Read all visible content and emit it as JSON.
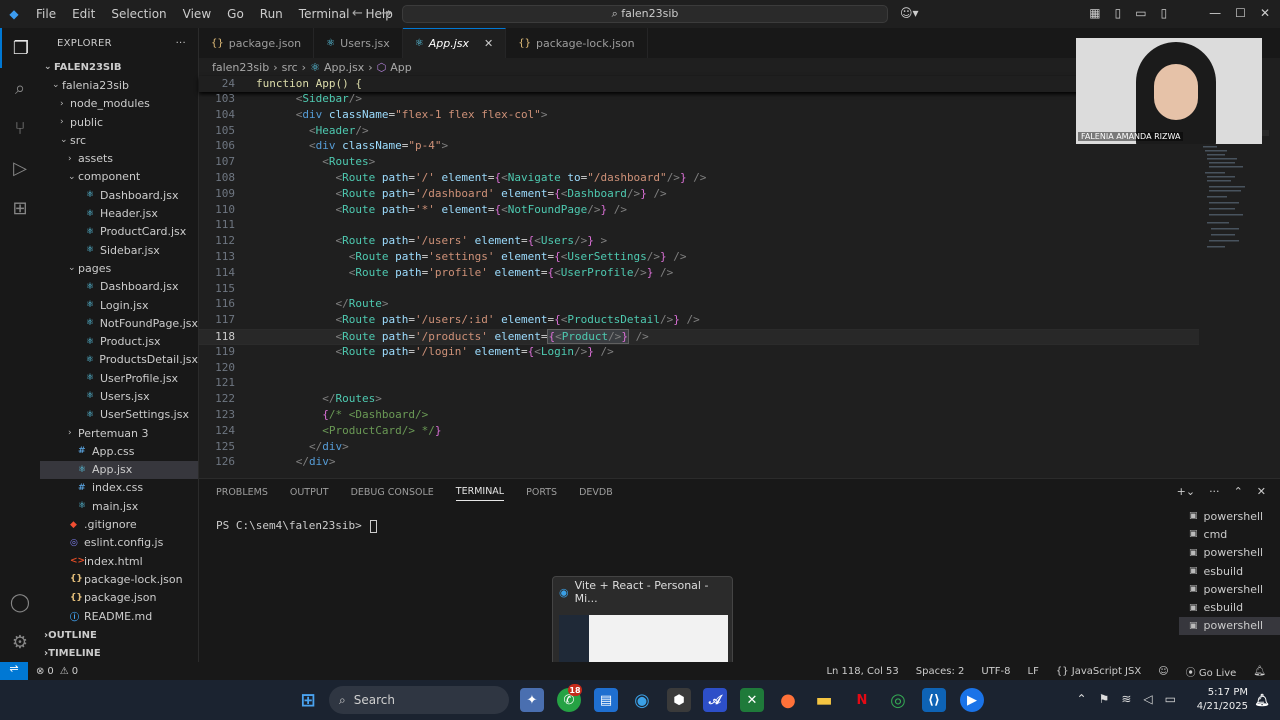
{
  "titlebar": {
    "menu": [
      "File",
      "Edit",
      "Selection",
      "View",
      "Go",
      "Run",
      "Terminal",
      "Help"
    ],
    "command_center": "falen23sib"
  },
  "sidebar": {
    "header": "EXPLORER",
    "root": "FALEN23SIB",
    "tree": [
      {
        "label": "falenia23sib",
        "depth": 1,
        "kind": "folder-open"
      },
      {
        "label": "node_modules",
        "depth": 2,
        "kind": "folder"
      },
      {
        "label": "public",
        "depth": 2,
        "kind": "folder"
      },
      {
        "label": "src",
        "depth": 2,
        "kind": "folder-open"
      },
      {
        "label": "assets",
        "depth": 3,
        "kind": "folder"
      },
      {
        "label": "component",
        "depth": 3,
        "kind": "folder-open"
      },
      {
        "label": "Dashboard.jsx",
        "depth": 4,
        "kind": "jsx"
      },
      {
        "label": "Header.jsx",
        "depth": 4,
        "kind": "jsx"
      },
      {
        "label": "ProductCard.jsx",
        "depth": 4,
        "kind": "jsx"
      },
      {
        "label": "Sidebar.jsx",
        "depth": 4,
        "kind": "jsx"
      },
      {
        "label": "pages",
        "depth": 3,
        "kind": "folder-open"
      },
      {
        "label": "Dashboard.jsx",
        "depth": 4,
        "kind": "jsx"
      },
      {
        "label": "Login.jsx",
        "depth": 4,
        "kind": "jsx"
      },
      {
        "label": "NotFoundPage.jsx",
        "depth": 4,
        "kind": "jsx"
      },
      {
        "label": "Product.jsx",
        "depth": 4,
        "kind": "jsx"
      },
      {
        "label": "ProductsDetail.jsx",
        "depth": 4,
        "kind": "jsx"
      },
      {
        "label": "UserProfile.jsx",
        "depth": 4,
        "kind": "jsx"
      },
      {
        "label": "Users.jsx",
        "depth": 4,
        "kind": "jsx"
      },
      {
        "label": "UserSettings.jsx",
        "depth": 4,
        "kind": "jsx"
      },
      {
        "label": "Pertemuan 3",
        "depth": 3,
        "kind": "folder"
      },
      {
        "label": "App.css",
        "depth": 3,
        "kind": "css"
      },
      {
        "label": "App.jsx",
        "depth": 3,
        "kind": "jsx",
        "selected": true
      },
      {
        "label": "index.css",
        "depth": 3,
        "kind": "css"
      },
      {
        "label": "main.jsx",
        "depth": 3,
        "kind": "jsx"
      },
      {
        "label": ".gitignore",
        "depth": 2,
        "kind": "git"
      },
      {
        "label": "eslint.config.js",
        "depth": 2,
        "kind": "eslint"
      },
      {
        "label": "index.html",
        "depth": 2,
        "kind": "html"
      },
      {
        "label": "package-lock.json",
        "depth": 2,
        "kind": "json"
      },
      {
        "label": "package.json",
        "depth": 2,
        "kind": "json"
      },
      {
        "label": "README.md",
        "depth": 2,
        "kind": "md"
      }
    ],
    "outline": "OUTLINE",
    "timeline": "TIMELINE"
  },
  "tabs": [
    {
      "label": "package.json",
      "icon": "{}",
      "active": false
    },
    {
      "label": "Users.jsx",
      "icon": "jsx",
      "active": false
    },
    {
      "label": "App.jsx",
      "icon": "jsx",
      "active": true
    },
    {
      "label": "package-lock.json",
      "icon": "{}",
      "active": false
    }
  ],
  "breadcrumbs": [
    "falen23sib",
    "src",
    "App.jsx",
    "App"
  ],
  "sticky": {
    "num": "24",
    "code": "function App() {"
  },
  "code_lines": [
    {
      "num": "103",
      "html": "      <span class=\"k\">&lt;</span><span class=\"t\">Sidebar</span><span class=\"k\">/&gt;</span>"
    },
    {
      "num": "104",
      "html": "      <span class=\"k\">&lt;</span><span class=\"kw\">div</span> <span class=\"a\">className</span><span class=\"p\">=</span><span class=\"s\">\"flex-1 flex flex-col\"</span><span class=\"k\">&gt;</span>"
    },
    {
      "num": "105",
      "html": "        <span class=\"k\">&lt;</span><span class=\"t\">Header</span><span class=\"k\">/&gt;</span>"
    },
    {
      "num": "106",
      "html": "        <span class=\"k\">&lt;</span><span class=\"kw\">div</span> <span class=\"a\">className</span><span class=\"p\">=</span><span class=\"s\">\"p-4\"</span><span class=\"k\">&gt;</span>"
    },
    {
      "num": "107",
      "html": "          <span class=\"k\">&lt;</span><span class=\"t\">Routes</span><span class=\"k\">&gt;</span>"
    },
    {
      "num": "108",
      "html": "            <span class=\"k\">&lt;</span><span class=\"t\">Route</span> <span class=\"a\">path</span><span class=\"p\">=</span><span class=\"s\">'/'</span> <span class=\"a\">element</span><span class=\"p\">=</span><span class=\"b\">{</span><span class=\"k\">&lt;</span><span class=\"t\">Navigate</span> <span class=\"a\">to</span><span class=\"p\">=</span><span class=\"s\">\"/dashboard\"</span><span class=\"k\">/&gt;</span><span class=\"b\">}</span> <span class=\"k\">/&gt;</span>"
    },
    {
      "num": "109",
      "html": "            <span class=\"k\">&lt;</span><span class=\"t\">Route</span> <span class=\"a\">path</span><span class=\"p\">=</span><span class=\"s\">'/dashboard'</span> <span class=\"a\">element</span><span class=\"p\">=</span><span class=\"b\">{</span><span class=\"k\">&lt;</span><span class=\"t\">Dashboard</span><span class=\"k\">/&gt;</span><span class=\"b\">}</span> <span class=\"k\">/&gt;</span>"
    },
    {
      "num": "110",
      "html": "            <span class=\"k\">&lt;</span><span class=\"t\">Route</span> <span class=\"a\">path</span><span class=\"p\">=</span><span class=\"s\">'*'</span> <span class=\"a\">element</span><span class=\"p\">=</span><span class=\"b\">{</span><span class=\"k\">&lt;</span><span class=\"t\">NotFoundPage</span><span class=\"k\">/&gt;</span><span class=\"b\">}</span> <span class=\"k\">/&gt;</span>"
    },
    {
      "num": "111",
      "html": ""
    },
    {
      "num": "112",
      "html": "            <span class=\"k\">&lt;</span><span class=\"t\">Route</span> <span class=\"a\">path</span><span class=\"p\">=</span><span class=\"s\">'/users'</span> <span class=\"a\">element</span><span class=\"p\">=</span><span class=\"b\">{</span><span class=\"k\">&lt;</span><span class=\"t\">Users</span><span class=\"k\">/&gt;</span><span class=\"b\">}</span> <span class=\"k\">&gt;</span>"
    },
    {
      "num": "113",
      "html": "              <span class=\"k\">&lt;</span><span class=\"t\">Route</span> <span class=\"a\">path</span><span class=\"p\">=</span><span class=\"s\">'settings'</span> <span class=\"a\">element</span><span class=\"p\">=</span><span class=\"b\">{</span><span class=\"k\">&lt;</span><span class=\"t\">UserSettings</span><span class=\"k\">/&gt;</span><span class=\"b\">}</span> <span class=\"k\">/&gt;</span>"
    },
    {
      "num": "114",
      "html": "              <span class=\"k\">&lt;</span><span class=\"t\">Route</span> <span class=\"a\">path</span><span class=\"p\">=</span><span class=\"s\">'profile'</span> <span class=\"a\">element</span><span class=\"p\">=</span><span class=\"b\">{</span><span class=\"k\">&lt;</span><span class=\"t\">UserProfile</span><span class=\"k\">/&gt;</span><span class=\"b\">}</span> <span class=\"k\">/&gt;</span>"
    },
    {
      "num": "115",
      "html": ""
    },
    {
      "num": "116",
      "html": "            <span class=\"k\">&lt;/</span><span class=\"t\">Route</span><span class=\"k\">&gt;</span>"
    },
    {
      "num": "117",
      "html": "            <span class=\"k\">&lt;</span><span class=\"t\">Route</span> <span class=\"a\">path</span><span class=\"p\">=</span><span class=\"s\">'/users/:id'</span> <span class=\"a\">element</span><span class=\"p\">=</span><span class=\"b\">{</span><span class=\"k\">&lt;</span><span class=\"t\">ProductsDetail</span><span class=\"k\">/&gt;</span><span class=\"b\">}</span> <span class=\"k\">/&gt;</span>"
    },
    {
      "num": "118",
      "html": "            <span class=\"k\">&lt;</span><span class=\"t\">Route</span> <span class=\"a\">path</span><span class=\"p\">=</span><span class=\"s\">'/products'</span> <span class=\"a\">element</span><span class=\"p\">=</span><span class=\"hl\"><span class=\"b\">{</span><span class=\"k\">&lt;</span><span class=\"t\">Product</span><span class=\"k\">/&gt;</span><span class=\"b\">}</span></span> <span class=\"k\">/&gt;</span>",
      "current": true
    },
    {
      "num": "119",
      "html": "            <span class=\"k\">&lt;</span><span class=\"t\">Route</span> <span class=\"a\">path</span><span class=\"p\">=</span><span class=\"s\">'/login'</span> <span class=\"a\">element</span><span class=\"p\">=</span><span class=\"b\">{</span><span class=\"k\">&lt;</span><span class=\"t\">Login</span><span class=\"k\">/&gt;</span><span class=\"b\">}</span> <span class=\"k\">/&gt;</span>"
    },
    {
      "num": "120",
      "html": ""
    },
    {
      "num": "121",
      "html": ""
    },
    {
      "num": "122",
      "html": "          <span class=\"k\">&lt;/</span><span class=\"t\">Routes</span><span class=\"k\">&gt;</span>"
    },
    {
      "num": "123",
      "html": "          <span class=\"b\">{</span><span class=\"c\">/* &lt;Dashboard/&gt;</span>"
    },
    {
      "num": "124",
      "html": "          <span class=\"c\">&lt;ProductCard/&gt; */</span><span class=\"b\">}</span>"
    },
    {
      "num": "125",
      "html": "        <span class=\"k\">&lt;/</span><span class=\"kw\">div</span><span class=\"k\">&gt;</span>"
    },
    {
      "num": "126",
      "html": "      <span class=\"k\">&lt;/</span><span class=\"kw\">div</span><span class=\"k\">&gt;</span>"
    }
  ],
  "panel": {
    "tabs": [
      "PROBLEMS",
      "OUTPUT",
      "DEBUG CONSOLE",
      "TERMINAL",
      "PORTS",
      "DEVDB"
    ],
    "active_tab": "TERMINAL",
    "prompt": "PS C:\\sem4\\falen23sib> ",
    "terminals": [
      "powershell",
      "cmd",
      "powershell",
      "esbuild",
      "powershell",
      "esbuild",
      "powershell"
    ]
  },
  "statusbar": {
    "problems": "0",
    "warnings": "0",
    "position": "Ln 118, Col 53",
    "spaces": "Spaces: 2",
    "encoding": "UTF-8",
    "eol": "LF",
    "language": "JavaScript JSX",
    "golive": "Go Live"
  },
  "taskbar": {
    "search": "Search",
    "time": "5:17 PM",
    "date": "4/21/2025",
    "badge": "18"
  },
  "preview": {
    "title": "Vite + React - Personal - Mi..."
  },
  "video": {
    "name": "FALENIA AMANDA RIZWA"
  }
}
